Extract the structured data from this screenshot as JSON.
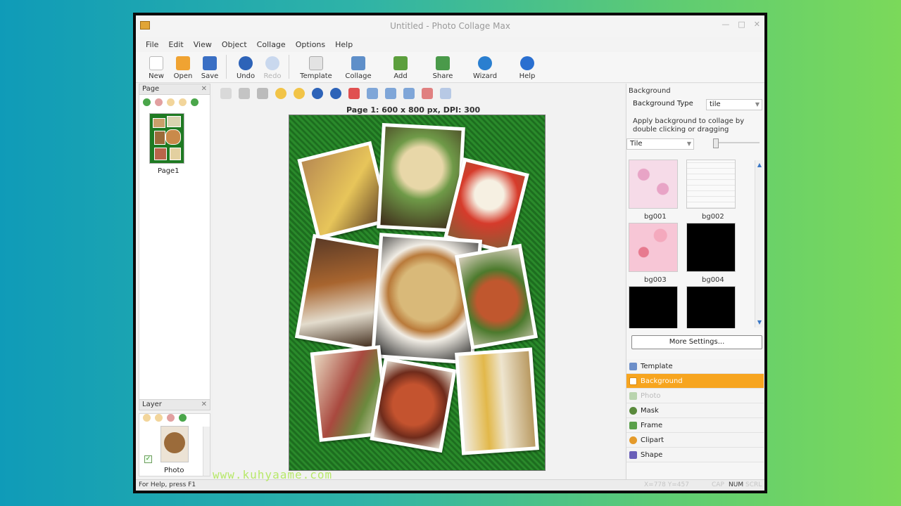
{
  "window": {
    "title": "Untitled - Photo Collage Max",
    "controls": [
      "—",
      "□",
      "✕"
    ]
  },
  "menu": [
    "File",
    "Edit",
    "View",
    "Object",
    "Collage",
    "Options",
    "Help"
  ],
  "toolbar": [
    {
      "label": "New",
      "icon": "new-file-icon",
      "color": "#ffffff",
      "enabled": true
    },
    {
      "label": "Open",
      "icon": "folder-open-icon",
      "color": "#f0a332",
      "enabled": true
    },
    {
      "label": "Save",
      "icon": "save-disk-icon",
      "color": "#3a6fc4",
      "enabled": true
    },
    {
      "label": "Undo",
      "icon": "undo-arrow-icon",
      "color": "#2d63b8",
      "enabled": true
    },
    {
      "label": "Redo",
      "icon": "redo-arrow-icon",
      "color": "#9fb8de",
      "enabled": false
    },
    {
      "label": "Template",
      "icon": "template-icon",
      "color": "#d8d8d8",
      "enabled": true
    },
    {
      "label": "Collage",
      "icon": "collage-icon",
      "color": "#5f8fc9",
      "enabled": true
    },
    {
      "label": "Add",
      "icon": "add-photo-icon",
      "color": "#5c9f3d",
      "enabled": true
    },
    {
      "label": "Share",
      "icon": "share-icon",
      "color": "#e6602b",
      "enabled": true
    },
    {
      "label": "Wizard",
      "icon": "wizard-globe-icon",
      "color": "#2a7fd0",
      "enabled": true
    },
    {
      "label": "Help",
      "icon": "help-icon",
      "color": "#2a6fd0",
      "enabled": true
    }
  ],
  "page_panel": {
    "title": "Page",
    "close": "✕",
    "pages": [
      {
        "label": "Page1"
      }
    ]
  },
  "layer_panel": {
    "title": "Layer",
    "close": "✕",
    "check": "✓",
    "layers": [
      {
        "label": "Photo"
      }
    ]
  },
  "canvas": {
    "page_info": "Page 1: 600 x 800 px, DPI: 300",
    "background_color": "#237a24"
  },
  "background_panel": {
    "title": "Background",
    "type_label": "Background Type",
    "type_value": "tile",
    "description": "Apply background to collage by double clicking or dragging",
    "mode_value": "Tile",
    "slider_level": 0.1,
    "items": [
      {
        "name": "bg001",
        "color": "#f2c9dc"
      },
      {
        "name": "bg002",
        "color": "#f7f7f7"
      },
      {
        "name": "bg003",
        "color": "#f6c6d6"
      },
      {
        "name": "bg004",
        "color": "#000000"
      },
      {
        "name": "",
        "color": "#000000"
      },
      {
        "name": "",
        "color": "#000000"
      }
    ],
    "more_button": "More Settings..."
  },
  "tabs": [
    {
      "label": "Template",
      "icon": "template-tab-icon",
      "color": "#6d8fc9",
      "state": "normal"
    },
    {
      "label": "Background",
      "icon": "background-tab-icon",
      "color": "#ffffff",
      "state": "active"
    },
    {
      "label": "Photo",
      "icon": "photo-tab-icon",
      "color": "#6aa35a",
      "state": "muted"
    },
    {
      "label": "Mask",
      "icon": "mask-tab-icon",
      "color": "#5a8a3c",
      "state": "normal"
    },
    {
      "label": "Frame",
      "icon": "frame-tab-icon",
      "color": "#5aa04a",
      "state": "normal"
    },
    {
      "label": "Clipart",
      "icon": "clipart-tab-icon",
      "color": "#e49a2a",
      "state": "normal"
    },
    {
      "label": "Shape",
      "icon": "shape-tab-icon",
      "color": "#6a5fb9",
      "state": "normal"
    }
  ],
  "statusbar": {
    "help": "For Help, press F1",
    "coords": "X=778 Y=457",
    "cap": "CAP",
    "num": "NUM",
    "scrl": "SCRL"
  },
  "watermark": "www.kuhyaame.com"
}
